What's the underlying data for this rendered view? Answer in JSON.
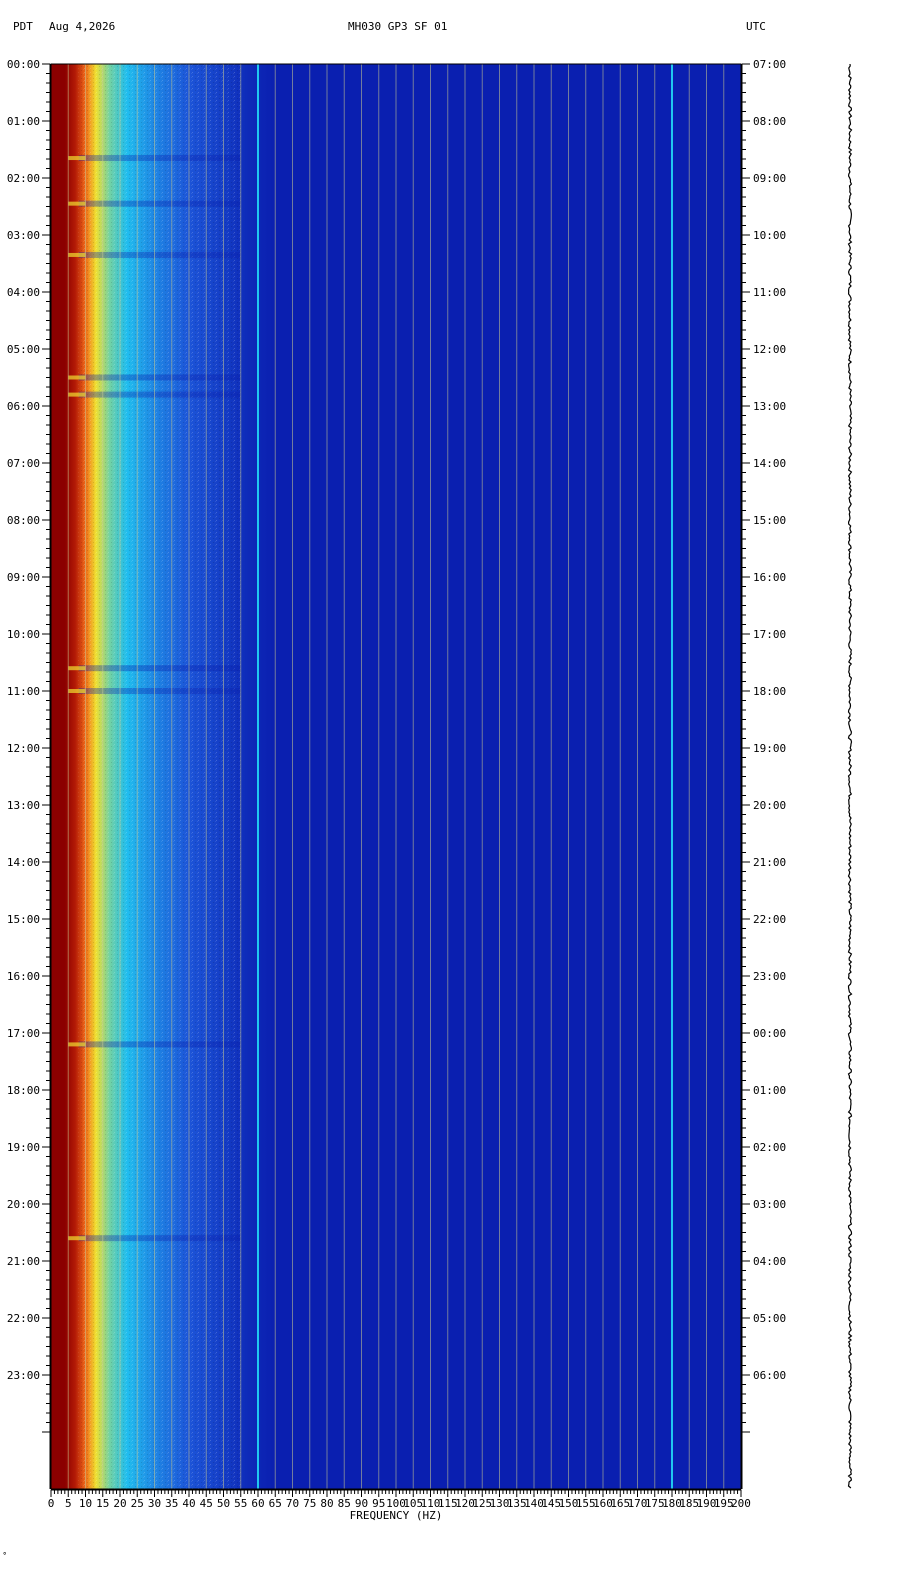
{
  "header": {
    "left_tz": "PDT",
    "date": "Aug 4,2026",
    "station": "MH030 GP3 SF 01",
    "right_tz": "UTC"
  },
  "footer_mark": "˚",
  "colors": {
    "background": "#ffffff",
    "floor": "#0a1fb0",
    "gridline": "#c8c890",
    "hum_line": "#20c8f0",
    "axis": "#000000"
  },
  "chart_data": {
    "type": "heatmap",
    "title": "MH030 GP3 SF 01",
    "xlabel": "FREQUENCY (HZ)",
    "ylabel_left": "PDT",
    "ylabel_right": "UTC",
    "xlim": [
      0,
      200
    ],
    "x_ticks": [
      0,
      5,
      10,
      15,
      20,
      25,
      30,
      35,
      40,
      45,
      50,
      55,
      60,
      65,
      70,
      75,
      80,
      85,
      90,
      95,
      100,
      105,
      110,
      115,
      120,
      125,
      130,
      135,
      140,
      145,
      150,
      155,
      160,
      165,
      170,
      175,
      180,
      185,
      190,
      195,
      200
    ],
    "ylim_hours": [
      0,
      25
    ],
    "left_time_labels": [
      "00:00",
      "01:00",
      "02:00",
      "03:00",
      "04:00",
      "05:00",
      "06:00",
      "07:00",
      "08:00",
      "09:00",
      "10:00",
      "11:00",
      "12:00",
      "13:00",
      "14:00",
      "15:00",
      "16:00",
      "17:00",
      "18:00",
      "19:00",
      "20:00",
      "21:00",
      "22:00",
      "23:00"
    ],
    "right_time_labels": [
      "07:00",
      "08:00",
      "09:00",
      "10:00",
      "11:00",
      "12:00",
      "13:00",
      "14:00",
      "15:00",
      "16:00",
      "17:00",
      "18:00",
      "19:00",
      "20:00",
      "21:00",
      "22:00",
      "23:00",
      "00:00",
      "01:00",
      "02:00",
      "03:00",
      "04:00",
      "05:00",
      "06:00"
    ],
    "colormap": [
      "#0a1fb0",
      "#1e5adc",
      "#20c8f0",
      "#f0e030",
      "#f04010",
      "#8b0000"
    ],
    "spectral_profile": [
      {
        "hz": 0,
        "level": 1.0
      },
      {
        "hz": 4,
        "level": 1.0
      },
      {
        "hz": 7,
        "level": 0.92
      },
      {
        "hz": 10,
        "level": 0.75
      },
      {
        "hz": 13,
        "level": 0.6
      },
      {
        "hz": 17,
        "level": 0.48
      },
      {
        "hz": 22,
        "level": 0.38
      },
      {
        "hz": 30,
        "level": 0.28
      },
      {
        "hz": 40,
        "level": 0.18
      },
      {
        "hz": 50,
        "level": 0.1
      },
      {
        "hz": 57,
        "level": 0.04
      },
      {
        "hz": 65,
        "level": 0.0
      },
      {
        "hz": 200,
        "level": 0.0
      }
    ],
    "persistent_lines_hz": [
      60,
      180
    ],
    "transient_bands_hours": [
      1.65,
      2.45,
      3.35,
      5.5,
      5.8,
      10.6,
      11.0,
      17.2,
      20.6
    ]
  }
}
